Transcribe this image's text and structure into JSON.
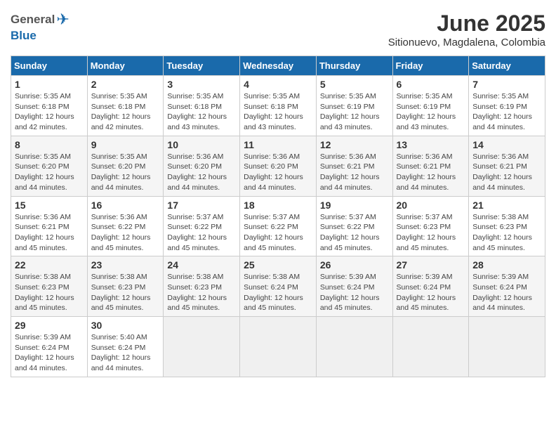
{
  "header": {
    "logo_general": "General",
    "logo_blue": "Blue",
    "month": "June 2025",
    "location": "Sitionuevo, Magdalena, Colombia"
  },
  "weekdays": [
    "Sunday",
    "Monday",
    "Tuesday",
    "Wednesday",
    "Thursday",
    "Friday",
    "Saturday"
  ],
  "weeks": [
    [
      {
        "day": "1",
        "info": "Sunrise: 5:35 AM\nSunset: 6:18 PM\nDaylight: 12 hours\nand 42 minutes."
      },
      {
        "day": "2",
        "info": "Sunrise: 5:35 AM\nSunset: 6:18 PM\nDaylight: 12 hours\nand 42 minutes."
      },
      {
        "day": "3",
        "info": "Sunrise: 5:35 AM\nSunset: 6:18 PM\nDaylight: 12 hours\nand 43 minutes."
      },
      {
        "day": "4",
        "info": "Sunrise: 5:35 AM\nSunset: 6:18 PM\nDaylight: 12 hours\nand 43 minutes."
      },
      {
        "day": "5",
        "info": "Sunrise: 5:35 AM\nSunset: 6:19 PM\nDaylight: 12 hours\nand 43 minutes."
      },
      {
        "day": "6",
        "info": "Sunrise: 5:35 AM\nSunset: 6:19 PM\nDaylight: 12 hours\nand 43 minutes."
      },
      {
        "day": "7",
        "info": "Sunrise: 5:35 AM\nSunset: 6:19 PM\nDaylight: 12 hours\nand 44 minutes."
      }
    ],
    [
      {
        "day": "8",
        "info": "Sunrise: 5:35 AM\nSunset: 6:20 PM\nDaylight: 12 hours\nand 44 minutes."
      },
      {
        "day": "9",
        "info": "Sunrise: 5:35 AM\nSunset: 6:20 PM\nDaylight: 12 hours\nand 44 minutes."
      },
      {
        "day": "10",
        "info": "Sunrise: 5:36 AM\nSunset: 6:20 PM\nDaylight: 12 hours\nand 44 minutes."
      },
      {
        "day": "11",
        "info": "Sunrise: 5:36 AM\nSunset: 6:20 PM\nDaylight: 12 hours\nand 44 minutes."
      },
      {
        "day": "12",
        "info": "Sunrise: 5:36 AM\nSunset: 6:21 PM\nDaylight: 12 hours\nand 44 minutes."
      },
      {
        "day": "13",
        "info": "Sunrise: 5:36 AM\nSunset: 6:21 PM\nDaylight: 12 hours\nand 44 minutes."
      },
      {
        "day": "14",
        "info": "Sunrise: 5:36 AM\nSunset: 6:21 PM\nDaylight: 12 hours\nand 44 minutes."
      }
    ],
    [
      {
        "day": "15",
        "info": "Sunrise: 5:36 AM\nSunset: 6:21 PM\nDaylight: 12 hours\nand 45 minutes."
      },
      {
        "day": "16",
        "info": "Sunrise: 5:36 AM\nSunset: 6:22 PM\nDaylight: 12 hours\nand 45 minutes."
      },
      {
        "day": "17",
        "info": "Sunrise: 5:37 AM\nSunset: 6:22 PM\nDaylight: 12 hours\nand 45 minutes."
      },
      {
        "day": "18",
        "info": "Sunrise: 5:37 AM\nSunset: 6:22 PM\nDaylight: 12 hours\nand 45 minutes."
      },
      {
        "day": "19",
        "info": "Sunrise: 5:37 AM\nSunset: 6:22 PM\nDaylight: 12 hours\nand 45 minutes."
      },
      {
        "day": "20",
        "info": "Sunrise: 5:37 AM\nSunset: 6:23 PM\nDaylight: 12 hours\nand 45 minutes."
      },
      {
        "day": "21",
        "info": "Sunrise: 5:38 AM\nSunset: 6:23 PM\nDaylight: 12 hours\nand 45 minutes."
      }
    ],
    [
      {
        "day": "22",
        "info": "Sunrise: 5:38 AM\nSunset: 6:23 PM\nDaylight: 12 hours\nand 45 minutes."
      },
      {
        "day": "23",
        "info": "Sunrise: 5:38 AM\nSunset: 6:23 PM\nDaylight: 12 hours\nand 45 minutes."
      },
      {
        "day": "24",
        "info": "Sunrise: 5:38 AM\nSunset: 6:23 PM\nDaylight: 12 hours\nand 45 minutes."
      },
      {
        "day": "25",
        "info": "Sunrise: 5:38 AM\nSunset: 6:24 PM\nDaylight: 12 hours\nand 45 minutes."
      },
      {
        "day": "26",
        "info": "Sunrise: 5:39 AM\nSunset: 6:24 PM\nDaylight: 12 hours\nand 45 minutes."
      },
      {
        "day": "27",
        "info": "Sunrise: 5:39 AM\nSunset: 6:24 PM\nDaylight: 12 hours\nand 45 minutes."
      },
      {
        "day": "28",
        "info": "Sunrise: 5:39 AM\nSunset: 6:24 PM\nDaylight: 12 hours\nand 44 minutes."
      }
    ],
    [
      {
        "day": "29",
        "info": "Sunrise: 5:39 AM\nSunset: 6:24 PM\nDaylight: 12 hours\nand 44 minutes."
      },
      {
        "day": "30",
        "info": "Sunrise: 5:40 AM\nSunset: 6:24 PM\nDaylight: 12 hours\nand 44 minutes."
      },
      null,
      null,
      null,
      null,
      null
    ]
  ]
}
